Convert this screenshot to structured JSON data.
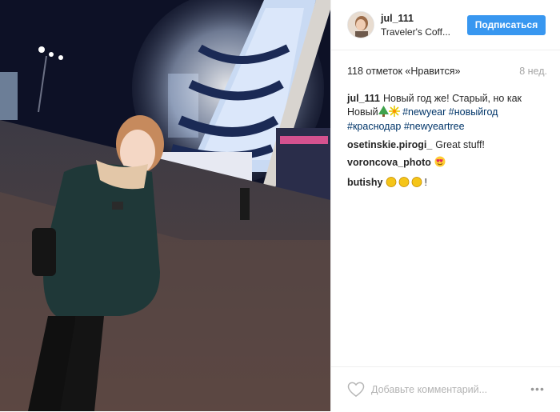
{
  "post": {
    "photo": {
      "description_icon": "photo"
    },
    "header": {
      "username": "jul_111",
      "location": "Traveler's Coff...",
      "follow_label": "Подписаться"
    },
    "likes": "118 отметок «Нравится»",
    "time_ago": "8 нед.",
    "caption": {
      "user": "jul_111",
      "text_before": "Новый год же! Старый, но как Новый",
      "emoji": [
        "tree-emoji",
        "fireworks-emoji"
      ],
      "hashtags": [
        "#newyear",
        "#новыйгод",
        "#краснодар",
        "#newyeartree"
      ]
    },
    "comments": [
      {
        "user": "osetinskie.pirogi_",
        "text": "Great stuff!"
      },
      {
        "user": "voroncova_photo",
        "text": "",
        "emoji": "heart-eyes-emoji"
      },
      {
        "user": "butishy",
        "text": "!",
        "emoji": "clapping-hands-emoji"
      }
    ],
    "comment_placeholder": "Добавьте комментарий...",
    "more_label": "•••",
    "colors": {
      "follow_button": "#3897f0",
      "hashtag": "#003569",
      "muted": "#a5a5a5"
    }
  }
}
